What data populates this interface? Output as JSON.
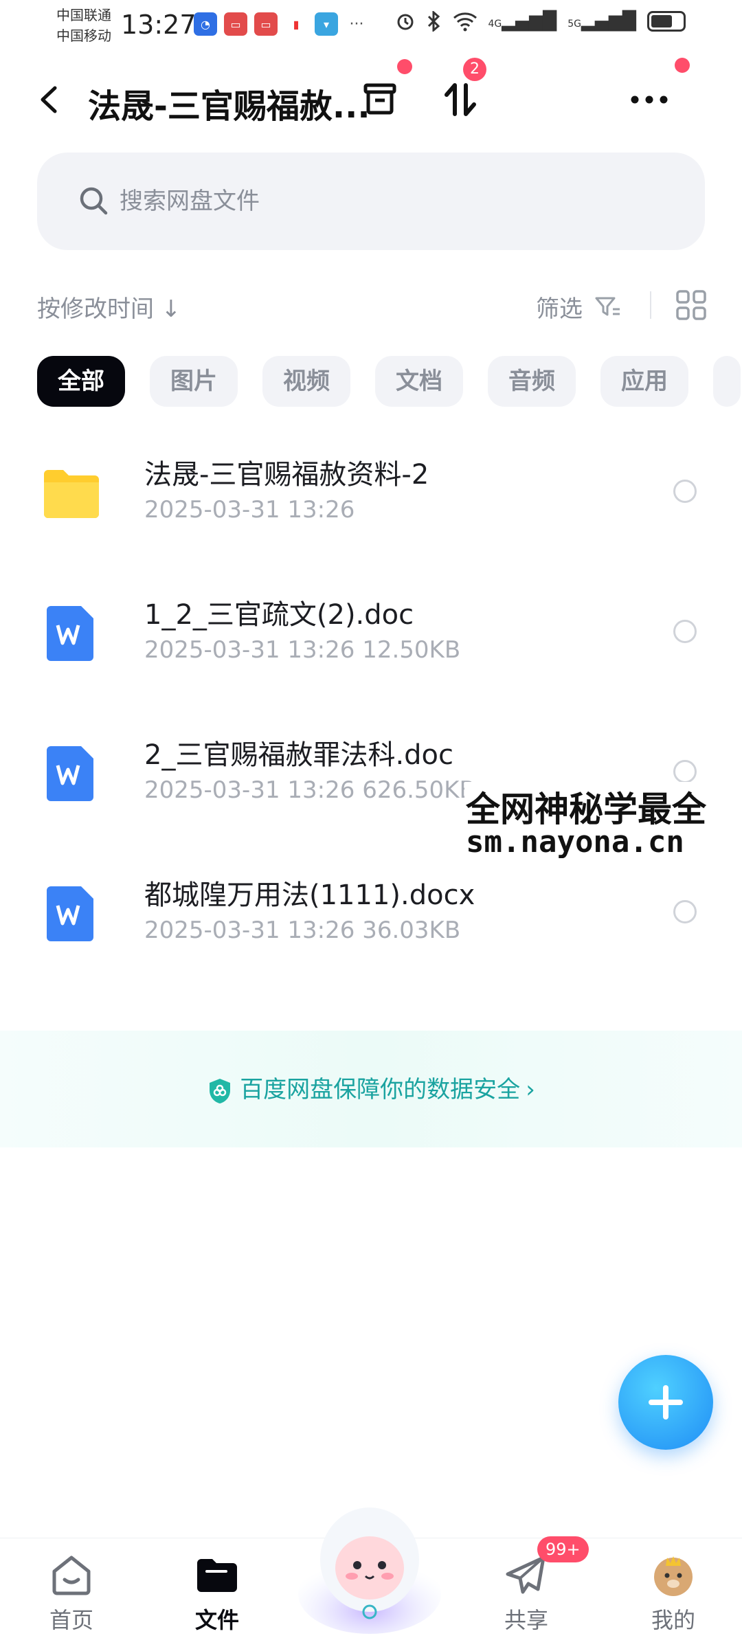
{
  "status_bar": {
    "carrier_1": "中国联通",
    "carrier_2": "中国移动",
    "time": "13:27",
    "network_1": "4G",
    "network_2": "5G"
  },
  "header": {
    "title": "法晟-三官赐福赦...",
    "transfer_badge": "2"
  },
  "search": {
    "placeholder": "搜索网盘文件"
  },
  "sort": {
    "label": "按修改时间 ↓",
    "filter_label": "筛选"
  },
  "categories": [
    "全部",
    "图片",
    "视频",
    "文档",
    "音频",
    "应用"
  ],
  "files": [
    {
      "name": "法晟-三官赐福赦资料-2",
      "meta": "2025-03-31  13:26",
      "type": "folder"
    },
    {
      "name": "1_2_三官疏文(2).doc",
      "meta": "2025-03-31  13:26  12.50KB",
      "type": "word"
    },
    {
      "name": "2_三官赐福赦罪法科.doc",
      "meta": "2025-03-31  13:26  626.50KB",
      "type": "word"
    },
    {
      "name": "都城隍万用法(1111).docx",
      "meta": "2025-03-31  13:26  36.03KB",
      "type": "word"
    }
  ],
  "watermark": {
    "line1": "全网神秘学最全",
    "line2": "sm.nayona.cn"
  },
  "security_banner": {
    "text": "百度网盘保障你的数据安全"
  },
  "bottom_nav": {
    "home": "首页",
    "files": "文件",
    "share": "共享",
    "share_badge": "99+",
    "mine": "我的"
  },
  "colors": {
    "accent_blue": "#1f8df5",
    "badge_red": "#ff4d6a",
    "secure_teal": "#1aa3a0",
    "folder_yellow": "#ffd33d",
    "word_blue": "#3b82f6"
  }
}
